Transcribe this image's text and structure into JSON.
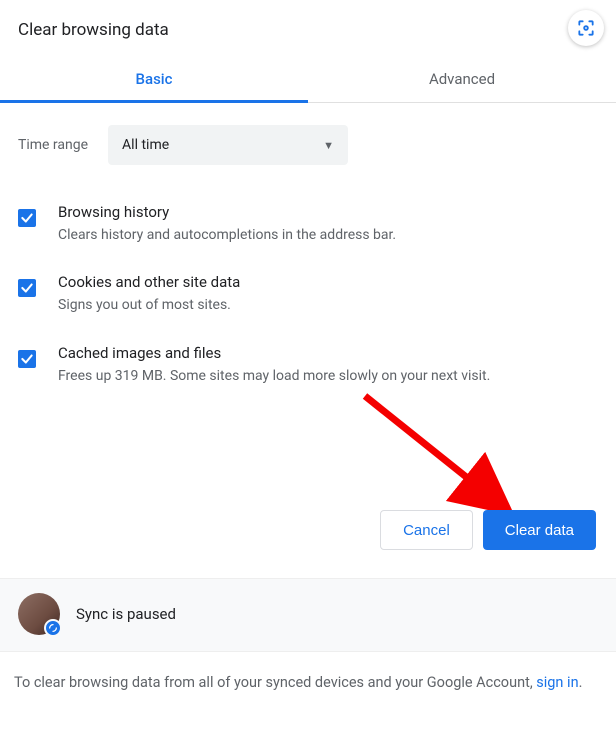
{
  "title": "Clear browsing data",
  "tabs": {
    "basic": "Basic",
    "advanced": "Advanced"
  },
  "timeRange": {
    "label": "Time range",
    "value": "All time"
  },
  "options": [
    {
      "title": "Browsing history",
      "desc": "Clears history and autocompletions in the address bar."
    },
    {
      "title": "Cookies and other site data",
      "desc": "Signs you out of most sites."
    },
    {
      "title": "Cached images and files",
      "desc": "Frees up 319 MB. Some sites may load more slowly on your next visit."
    }
  ],
  "buttons": {
    "cancel": "Cancel",
    "clear": "Clear data"
  },
  "sync": {
    "status": "Sync is paused"
  },
  "note": {
    "text": "To clear browsing data from all of your synced devices and your Google Account, ",
    "link": "sign in",
    "after": "."
  }
}
